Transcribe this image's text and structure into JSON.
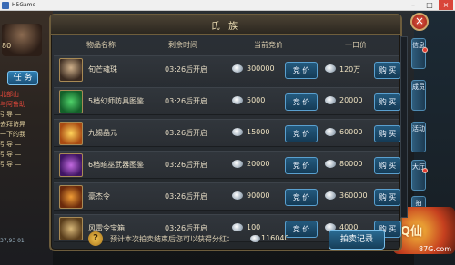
{
  "window": {
    "title": "H5Game"
  },
  "hud_left": {
    "level": "80",
    "task_label": "任 务",
    "entries": [
      {
        "text": "北部山",
        "color": "red"
      },
      {
        "text": "与阿鲁助",
        "color": "red"
      },
      {
        "text": "引导 —",
        "color": "normal"
      },
      {
        "text": "去拜访异",
        "color": "normal"
      },
      {
        "text": "一下的我",
        "color": "normal"
      },
      {
        "text": "引导 —",
        "color": "normal"
      },
      {
        "text": "引导 —",
        "color": "normal"
      },
      {
        "text": "引导 —",
        "color": "normal"
      }
    ],
    "coords": "37,93 01"
  },
  "hud_right": {
    "tabs": [
      "信息",
      "成员",
      "活动",
      "大厅"
    ],
    "auction_tab": "拍",
    "logo_text": "Q仙",
    "watermark": "87G.com"
  },
  "dialog": {
    "title": "氏 族",
    "headers": {
      "name": "物品名称",
      "time": "剩余时间",
      "current_bid": "当前竞价",
      "buyout": "一口价"
    },
    "rows": [
      {
        "name": "旬芒魂珠",
        "time": "03:26后开启",
        "bid": "300000",
        "bid_btn": "竞 价",
        "buyout": "120万",
        "buy_btn": "购 买",
        "icon": "portrait-icon"
      },
      {
        "name": "5档幻师防具图鉴",
        "time": "03:26后开启",
        "bid": "5000",
        "bid_btn": "竞 价",
        "buyout": "20000",
        "buy_btn": "购 买",
        "icon": "armor-book-icon"
      },
      {
        "name": "九锡晶元",
        "time": "03:26后开启",
        "bid": "15000",
        "bid_btn": "竞 价",
        "buyout": "60000",
        "buy_btn": "购 买",
        "icon": "crystal-icon"
      },
      {
        "name": "6档暗巫武器图鉴",
        "time": "03:26后开启",
        "bid": "20000",
        "bid_btn": "竞 价",
        "buyout": "80000",
        "buy_btn": "购 买",
        "icon": "weapon-book-icon"
      },
      {
        "name": "豪杰令",
        "time": "03:26后开启",
        "bid": "90000",
        "bid_btn": "竞 价",
        "buyout": "360000",
        "buy_btn": "购 买",
        "icon": "token-icon"
      },
      {
        "name": "风雷令宝箱",
        "time": "03:26后开启",
        "bid": "100",
        "bid_btn": "竞 价",
        "buyout": "4000",
        "buy_btn": "购 买",
        "icon": "chest-icon"
      }
    ],
    "footer": {
      "text": "预计本次拍卖结束后您可以获得分红：",
      "value": "116040",
      "records_btn": "拍卖记录"
    }
  },
  "colors": {
    "accent": "#245a7e",
    "gold": "#d9ccae",
    "close": "#d9453a"
  }
}
